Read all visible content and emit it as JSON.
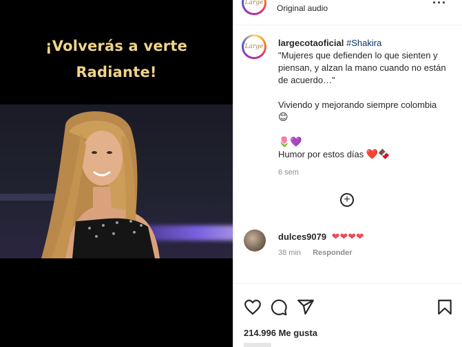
{
  "media": {
    "overlay_line1": "¡Volverás a verte",
    "overlay_line2": "Radiante!"
  },
  "header": {
    "avatar_text": "Large",
    "audio_label": "Original audio",
    "more_icon": "more-horizontal-icon"
  },
  "caption": {
    "username": "largecotaoficial",
    "hashtag": "#Shakira",
    "quote": "\"Mujeres que defienden lo que sienten y piensan, y alzan la mano cuando no están de acuerdo…\"",
    "line2": "Viviendo y mejorando siempre colombia",
    "line2_emoji": "😊",
    "line3_emoji": "🌷💜",
    "line4": "Humor por estos días",
    "line4_emoji": "❤️🍫",
    "timestamp": "6 sem"
  },
  "comment": {
    "username": "dulces9079",
    "hearts": "❤❤❤❤",
    "time": "38 min",
    "reply_label": "Responder"
  },
  "actions": {
    "like_icon": "heart-icon",
    "comment_icon": "comment-icon",
    "share_icon": "share-icon",
    "save_icon": "bookmark-icon"
  },
  "likes": {
    "text": "214.996 Me gusta"
  },
  "colors": {
    "overlay_text": "#f0d48a",
    "hashtag": "#00376b",
    "heart": "#ed4956",
    "muted": "#8e8e8e"
  }
}
